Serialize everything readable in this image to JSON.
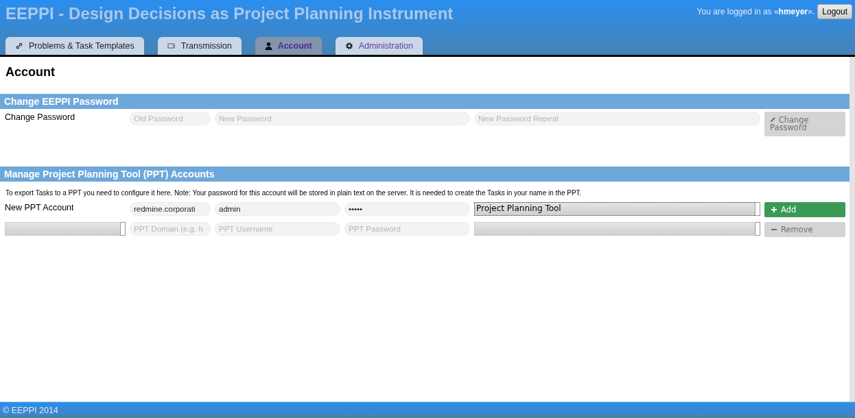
{
  "header": {
    "title": "EEPPI - **D**e**s**ign **D**e**c**isions as **P**roject **P**lanning **I**nstrument",
    "login_prefix": "You are logged in as «",
    "username": "hmeyer",
    "login_suffix": "».",
    "logout_button": "Logout"
  },
  "tabs": [
    {
      "label": "Problems & Task Templates",
      "selected": false
    },
    {
      "label": "Transmission",
      "selected": false
    },
    {
      "label": "Account",
      "selected": true
    },
    {
      "label": "Administration",
      "selected": false
    }
  ],
  "page_title": "Account",
  "password_section": {
    "title": "Change EEPPI Password",
    "label": "Change Password",
    "fields": [
      {
        "placeholder": "Old Password"
      },
      {
        "placeholder": "New Password"
      },
      {
        "placeholder": "New Password Repeat"
      }
    ],
    "button": {
      "label": "Change Password",
      "disabled": true
    }
  },
  "ppt_section": {
    "title": "Manage Project Planning Tool (PPT) Accounts",
    "note": "To export Tasks to a PPT you need to configure it here. Note: Your password for this account will be stored in plain text on the server. It is needed to create the Tasks in your name in the PPT.",
    "rows": [
      {
        "label": "New PPT Account",
        "selector": null,
        "fields": [
          {
            "value": "redmine.corporati"
          },
          {
            "value": "admin"
          },
          {
            "value": "•••••"
          }
        ],
        "tool": "Project Planning Tool",
        "tool_focused": true,
        "button": {
          "label": "Add",
          "kind": "add",
          "disabled": false
        }
      },
      {
        "label": null,
        "selector": "",
        "fields": [
          {
            "placeholder": "PPT Domain (e.g. h"
          },
          {
            "placeholder": "PPT Username"
          },
          {
            "placeholder": "PPT Password"
          }
        ],
        "tool": "",
        "tool_focused": false,
        "button": {
          "label": "Remove",
          "kind": "remove",
          "disabled": true
        }
      }
    ]
  },
  "footer": "© EEPPI 2014"
}
